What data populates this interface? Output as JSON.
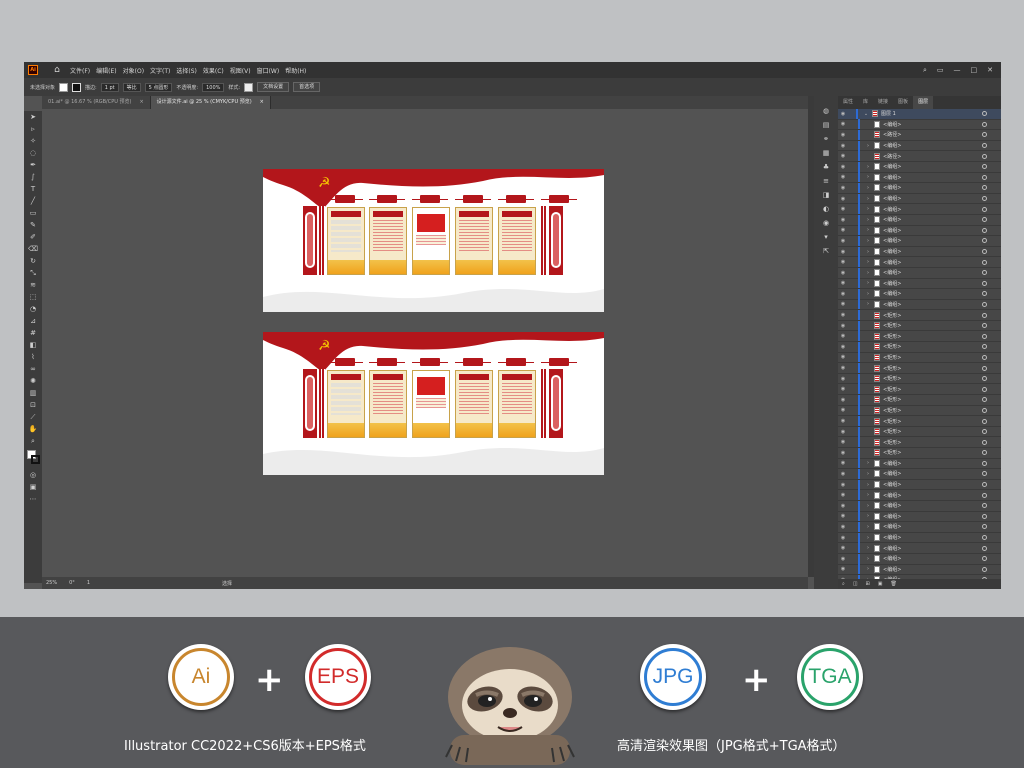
{
  "menu": {
    "logo": "Ai",
    "items": [
      "文件(F)",
      "编辑(E)",
      "对象(O)",
      "文字(T)",
      "选择(S)",
      "效果(C)",
      "视图(V)",
      "窗口(W)",
      "帮助(H)"
    ]
  },
  "control_bar": {
    "selection": "未选择对象",
    "stroke_label": "描边:",
    "stroke_value": "1 pt",
    "stroke_style": "等比",
    "brush": "5 点圆形",
    "opacity_label": "不透明度:",
    "opacity_value": "100%",
    "style_label": "样式:",
    "doc_setup": "文档设置",
    "preferences": "首选项"
  },
  "document_tabs": [
    {
      "label": "01.ai* @ 16.67 % (RGB/CPU 预览)",
      "close": "×",
      "active": false
    },
    {
      "label": "设计源文件.ai @ 25 % (CMYK/CPU 预览)",
      "close": "×",
      "active": true
    }
  ],
  "status_bar": {
    "zoom": "25%",
    "angle": "0°",
    "page": "1",
    "tool": "选择"
  },
  "panel_tabs": [
    "属性",
    "库",
    "链接",
    "图板",
    "图层"
  ],
  "layers": {
    "top": "图层 1",
    "rows": [
      "<编组>",
      "<路径>",
      "<编组>",
      "<路径>",
      "<编组>",
      "<编组>",
      "<编组>",
      "<编组>",
      "<编组>",
      "<编组>",
      "<编组>",
      "<编组>",
      "<编组>",
      "<编组>",
      "<编组>",
      "<编组>",
      "<编组>",
      "<编组>",
      "<矩形>",
      "<矩形>",
      "<矩形>",
      "<矩形>",
      "<矩形>",
      "<矩形>",
      "<矩形>",
      "<矩形>",
      "<矩形>",
      "<矩形>",
      "<矩形>",
      "<矩形>",
      "<矩形>",
      "<矩形>",
      "<编组>",
      "<编组>",
      "<编组>",
      "<编组>",
      "<编组>",
      "<编组>",
      "<编组>",
      "<编组>",
      "<编组>",
      "<编组>",
      "<编组>",
      "<编组>"
    ]
  },
  "banner": {
    "badges": [
      {
        "label": "Ai",
        "color": "#c8862e"
      },
      {
        "label": "EPS",
        "color": "#d22b2b"
      },
      {
        "label": "JPG",
        "color": "#2f7dd3"
      },
      {
        "label": "TGA",
        "color": "#2aa36b"
      }
    ],
    "plus": "+",
    "caption_left": "Illustrator CC2022+CS6版本+EPS格式",
    "caption_right": "高清渲染效果图（JPG格式+TGA格式）"
  },
  "colors": {
    "party_red": "#b3161b",
    "gold": "#f0a21c",
    "canvas": "#535353"
  }
}
